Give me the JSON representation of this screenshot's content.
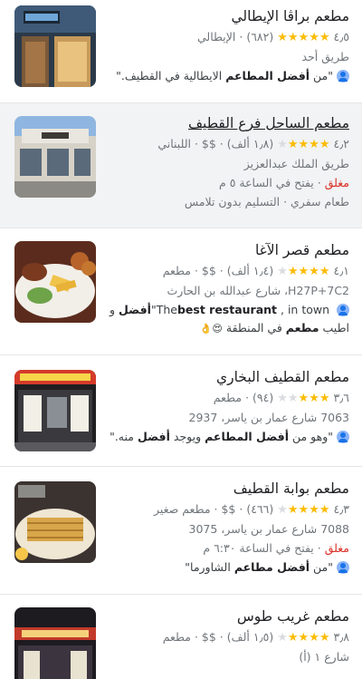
{
  "results": [
    {
      "name": "مطعم براڤا الإيطالي",
      "rating": "٤٫٥",
      "stars_filled": 5,
      "reviews": "(٦٨٢)",
      "category": "· الإيطالي",
      "address": "طريق أحد",
      "review_open": "\"من ",
      "review_b1": "أفضل المطاعم",
      "review_mid": " الايطالية في القطيف.\""
    },
    {
      "name": "مطعم الساحل فرع القطيف",
      "rating": "٤٫٢",
      "stars_filled": 4,
      "reviews": "(١٫٨ ألف)",
      "price": "· $$ ·",
      "category": "اللبناني",
      "address": "طريق الملك عبدالعزيز",
      "status": "مغلق",
      "hours": " · يفتح في الساعة ٥ م",
      "services": "طعام سفري · التسليم بدون تلامس"
    },
    {
      "name": "مطعم قصر الآغا",
      "rating": "٤٫١",
      "stars_filled": 4,
      "reviews": "(١٫٤ ألف)",
      "price": "· $$ ·",
      "category": "مطعم",
      "address": "H27P+7C2، شارع عبدالله بن الحارث",
      "review_line1_a": "\"The",
      "review_line1_b": "best restaurant",
      "review_line1_c": " , in town ",
      "review_line1_d": "أفضل",
      "review_line1_e": " و",
      "review_line2_a": "اطيب ",
      "review_line2_b": "مطعم",
      "review_line2_c": " في المنطقة ",
      "review_emoji": "😍👌"
    },
    {
      "name": "مطعم القطيف البخاري",
      "rating": "٣٫٦",
      "stars_filled": 3,
      "reviews": "(٩٤)",
      "category": "· مطعم",
      "address": "7063 شارع عمار بن ياسر، 2937",
      "review_open": "\"وهو من ",
      "review_b1": "أفضل المطاعم",
      "review_mid": " ويوجد ",
      "review_b2": "أفضل",
      "review_end": " منه.\""
    },
    {
      "name": "مطعم بوابة القطيف",
      "rating": "٤٫٣",
      "stars_filled": 4,
      "reviews": "(٤٦٦)",
      "price": "· $$ ·",
      "category": "مطعم صغير",
      "address": "7088 شارع عمار بن ياسر، 3075",
      "status": "مغلق",
      "hours": " · يفتح في الساعة ٦:٣٠ م",
      "review_open": "\"من ",
      "review_b1": "أفضل مطاعم",
      "review_mid": " الشاورما\""
    },
    {
      "name": "مطعم غريب طوس",
      "rating": "٣٫٨",
      "stars_filled": 4,
      "reviews": "(١٫٥ ألف)",
      "price": "· $$ ·",
      "category": "مطعم",
      "address": "شارع ١ (أ)"
    }
  ]
}
